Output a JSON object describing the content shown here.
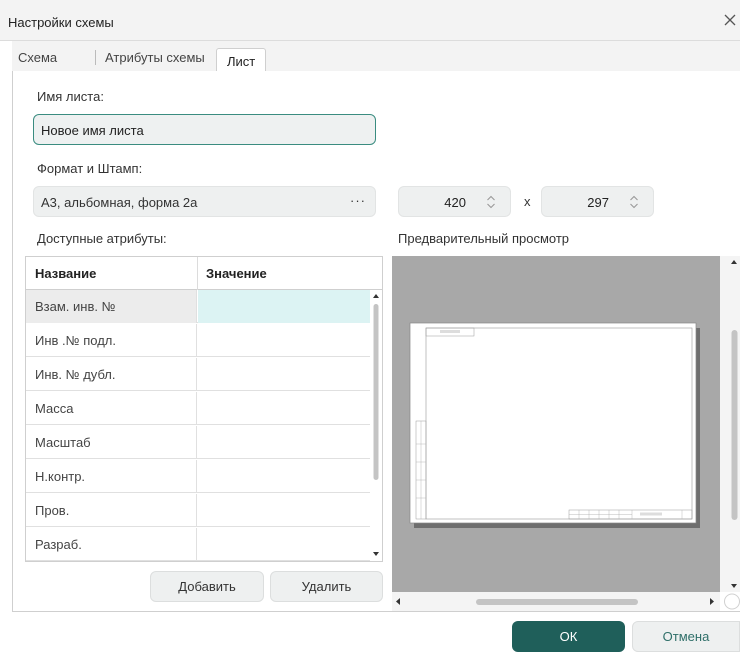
{
  "window": {
    "title": "Настройки схемы"
  },
  "tabs": [
    {
      "label": "Схема"
    },
    {
      "label": "Атрибуты схемы"
    },
    {
      "label": "Лист"
    }
  ],
  "sheet": {
    "name_label": "Имя листа:",
    "name_value": "Новое имя листа",
    "format_label": "Формат и Штамп:",
    "format_value": "А3, альбомная, форма 2а",
    "format_more": "···",
    "width": "420",
    "times": "x",
    "height": "297"
  },
  "attributes": {
    "label": "Доступные атрибуты:",
    "columns": [
      "Название",
      "Значение"
    ],
    "rows": [
      {
        "name": "Взам. инв. №",
        "value": ""
      },
      {
        "name": "Инв .№ подл.",
        "value": ""
      },
      {
        "name": "Инв. № дубл.",
        "value": ""
      },
      {
        "name": "Масса",
        "value": ""
      },
      {
        "name": "Масштаб",
        "value": ""
      },
      {
        "name": "Н.контр.",
        "value": ""
      },
      {
        "name": "Пров.",
        "value": ""
      },
      {
        "name": "Разраб.",
        "value": ""
      }
    ],
    "add_button": "Добавить",
    "delete_button": "Удалить"
  },
  "preview": {
    "label": "Предварительный просмотр"
  },
  "footer": {
    "ok": "ОК",
    "cancel": "Отмена"
  },
  "colors": {
    "accent": "#1f5f5a",
    "selected_value_cell": "#dcf3f3",
    "preview_background": "#a8a8a8"
  }
}
